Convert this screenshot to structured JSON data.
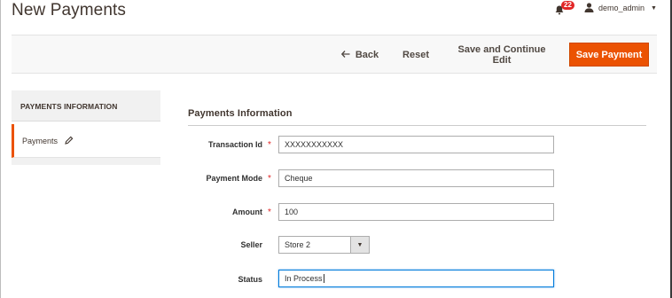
{
  "header": {
    "page_title": "New Payments",
    "notification_count": "22",
    "user_name": "demo_admin"
  },
  "actions": {
    "back_label": "Back",
    "reset_label": "Reset",
    "save_continue_label": "Save and Continue Edit",
    "save_label": "Save Payment"
  },
  "sidebar": {
    "heading": "PAYMENTS INFORMATION",
    "item_label": "Payments"
  },
  "form": {
    "section_title": "Payments Information",
    "fields": [
      {
        "label": "Transaction Id",
        "value": "XXXXXXXXXXX",
        "required": "*"
      },
      {
        "label": "Payment Mode",
        "value": "Cheque",
        "required": "*"
      },
      {
        "label": "Amount",
        "value": "100",
        "required": "*"
      },
      {
        "label": "Seller",
        "value": "Store 2"
      },
      {
        "label": "Status",
        "value": "In Process"
      }
    ]
  },
  "colors": {
    "accent": "#eb5202",
    "required": "#e22626",
    "badge": "#e22626",
    "focus": "#007bdb"
  },
  "icons": [
    "bell-icon",
    "user-icon",
    "caret-down-icon",
    "back-arrow-icon",
    "pencil-icon",
    "chevron-down-icon"
  ]
}
